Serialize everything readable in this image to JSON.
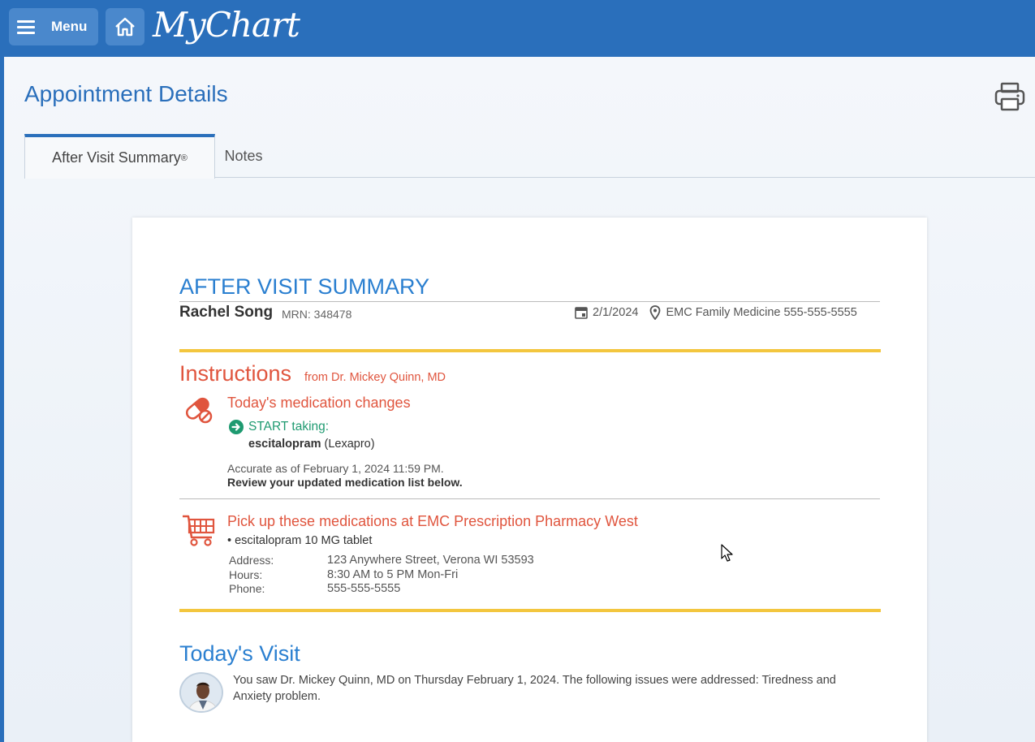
{
  "header": {
    "menu_label": "Menu",
    "logo_text": "MyChart",
    "brand_color": "#2a6fbb"
  },
  "page": {
    "title": "Appointment Details",
    "tabs": [
      {
        "label": "After Visit Summary",
        "sup": "®",
        "active": true
      },
      {
        "label": "Notes",
        "active": false
      }
    ]
  },
  "summary": {
    "heading": "AFTER VISIT SUMMARY",
    "patient_name": "Rachel Song",
    "mrn": "MRN: 348478",
    "visit_date": "2/1/2024",
    "location": "EMC Family Medicine 555-555-5555",
    "instructions": {
      "title": "Instructions",
      "from": "from Dr. Mickey Quinn, MD",
      "med_changes_title": "Today's medication changes",
      "start_label": "START taking:",
      "drug_name": "escitalopram",
      "drug_brand": "(Lexapro)",
      "accurate_as_of": "Accurate as of February 1, 2024 11:59 PM.",
      "review_note": "Review your updated medication list below."
    },
    "pharmacy": {
      "title": "Pick up these medications at EMC Prescription Pharmacy West",
      "item": "• escitalopram 10 MG tablet",
      "address_label": "Address:",
      "address": "123 Anywhere Street, Verona WI 53593",
      "hours_label": "Hours:",
      "hours": "8:30 AM to 5 PM Mon-Fri",
      "phone_label": "Phone:",
      "phone": "555-555-5555"
    },
    "visit": {
      "title": "Today's Visit",
      "text": "You saw Dr. Mickey Quinn, MD on Thursday February 1, 2024. The following issues were addressed: Tiredness and Anxiety problem."
    }
  },
  "colors": {
    "accent_blue": "#2a7fd0",
    "instruction_red": "#e0553e",
    "start_green": "#1e9a70",
    "divider_yellow": "#f3c63e"
  }
}
